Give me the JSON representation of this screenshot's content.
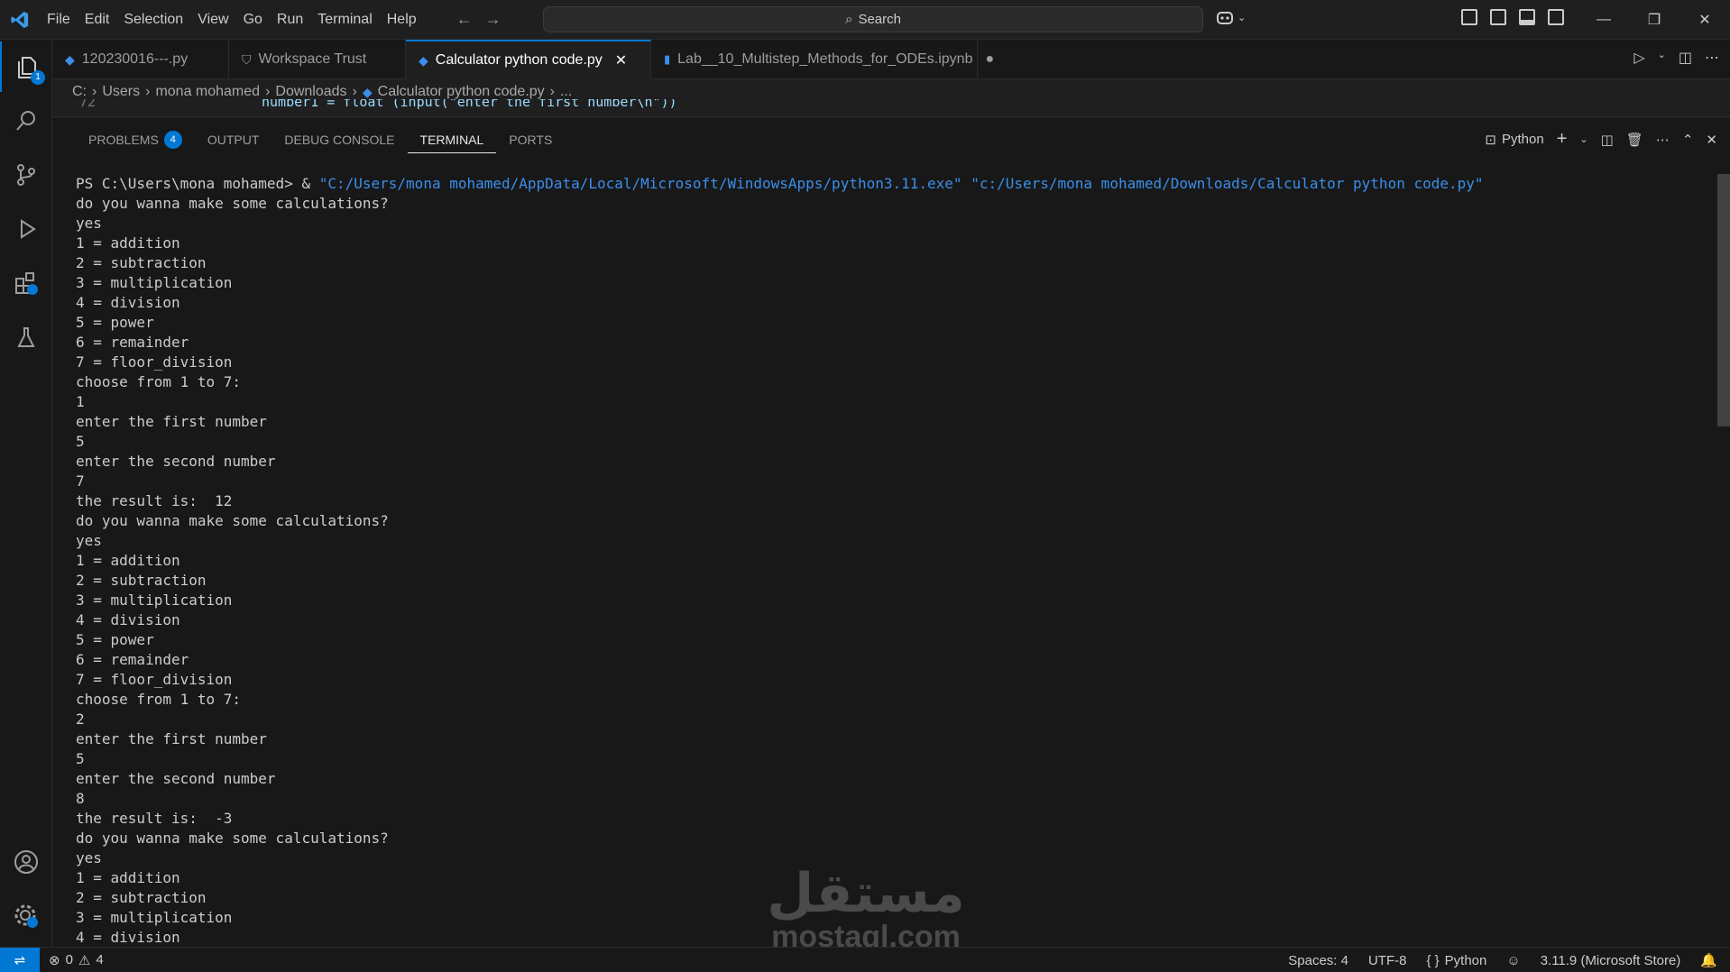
{
  "menu": [
    "File",
    "Edit",
    "Selection",
    "View",
    "Go",
    "Run",
    "Terminal",
    "Help"
  ],
  "search": {
    "label": "Search"
  },
  "tabs": [
    {
      "label": "120230016---.py",
      "icon": "python-icon"
    },
    {
      "label": "Workspace Trust",
      "icon": "shield-icon"
    },
    {
      "label": "Calculator python code.py",
      "icon": "python-icon",
      "active": true
    },
    {
      "label": "Lab__10_Multistep_Methods_for_ODEs.ipynb",
      "icon": "notebook-icon",
      "modified": true
    }
  ],
  "breadcrumb": [
    "C:",
    "Users",
    "mona mohamed",
    "Downloads",
    "Calculator python code.py",
    "..."
  ],
  "code_peek": {
    "line": "72",
    "code": "number1 = float (input(\"enter the first number\\n\"))"
  },
  "panel": {
    "tabs": [
      "PROBLEMS",
      "OUTPUT",
      "DEBUG CONSOLE",
      "TERMINAL",
      "PORTS"
    ],
    "problems_count": "4",
    "terminal_profile": "Python"
  },
  "terminal": {
    "prompt": "PS C:\\Users\\mona mohamed> & ",
    "cmd_exe": "\"C:/Users/mona mohamed/AppData/Local/Microsoft/WindowsApps/python3.11.exe\"",
    "cmd_file": "\"c:/Users/mona mohamed/Downloads/Calculator python code.py\"",
    "output": "do you wanna make some calculations?\nyes\n1 = addition\n2 = subtraction\n3 = multiplication\n4 = division\n5 = power\n6 = remainder\n7 = floor_division\nchoose from 1 to 7:\n1\nenter the first number\n5\nenter the second number\n7\nthe result is:  12\ndo you wanna make some calculations?\nyes\n1 = addition\n2 = subtraction\n3 = multiplication\n4 = division\n5 = power\n6 = remainder\n7 = floor_division\nchoose from 1 to 7:\n2\nenter the first number\n5\nenter the second number\n8\nthe result is:  -3\ndo you wanna make some calculations?\nyes\n1 = addition\n2 = subtraction\n3 = multiplication\n4 = division"
  },
  "watermark": {
    "arabic": "مستقل",
    "latin": "mostaql.com"
  },
  "status": {
    "errors": "0",
    "warnings": "4",
    "spaces": "Spaces: 4",
    "encoding": "UTF-8",
    "language": "Python",
    "interpreter": "3.11.9 (Microsoft Store)"
  },
  "colors": {
    "accent": "#0078d4",
    "string": "#3b8eea",
    "background": "#181818"
  }
}
